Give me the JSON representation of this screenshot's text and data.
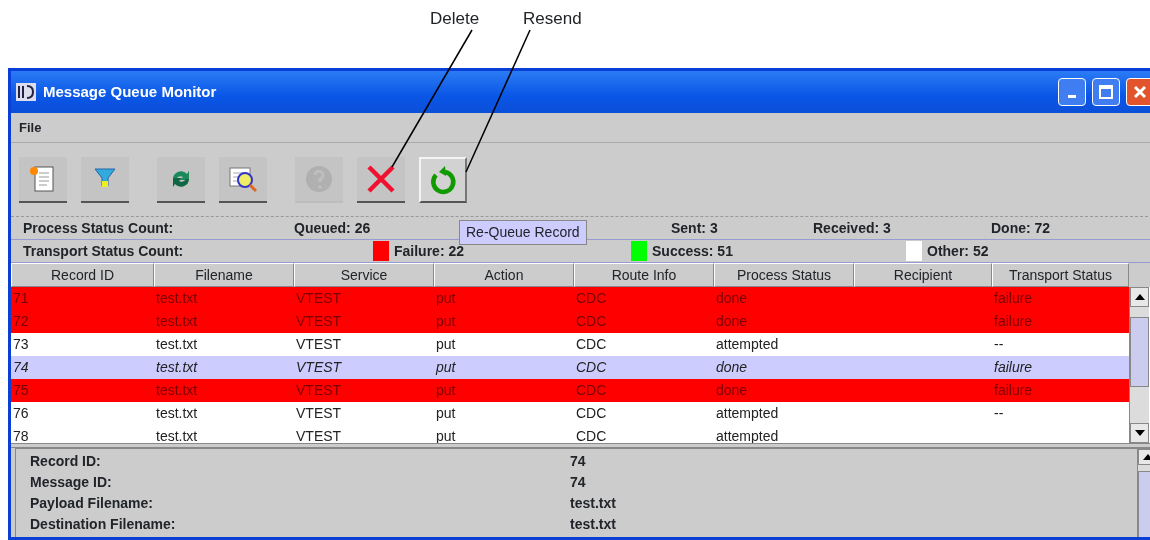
{
  "annotations": [
    {
      "label": "Delete"
    },
    {
      "label": "Resend"
    }
  ],
  "window": {
    "title": "Message Queue Monitor"
  },
  "menu": [
    {
      "label": "File"
    }
  ],
  "toolbar": [
    {
      "kind": "new",
      "disabled": false,
      "pressed": false
    },
    {
      "kind": "filter",
      "disabled": false,
      "pressed": false
    },
    {
      "kind": "refresh",
      "disabled": false,
      "pressed": false
    },
    {
      "kind": "view",
      "disabled": false,
      "pressed": false
    },
    {
      "kind": "help",
      "disabled": true,
      "pressed": false
    },
    {
      "kind": "delete",
      "disabled": false,
      "pressed": false
    },
    {
      "kind": "resend",
      "disabled": false,
      "pressed": true
    }
  ],
  "tooltip": "Re-Queue Record",
  "process_status": {
    "label": "Process Status Count:",
    "counts": [
      "Queued: 26",
      "Sent: 3",
      "Received: 3",
      "Done: 72"
    ]
  },
  "transport_status": {
    "label": "Transport Status Count:",
    "legend": [
      {
        "label": "Failure: 22",
        "color": "#ff0000"
      },
      {
        "label": "Success: 51",
        "color": "#00ff00"
      },
      {
        "label": "Other: 52",
        "color": "#ffffff"
      }
    ]
  },
  "table": {
    "columns": [
      "Record ID",
      "Filename",
      "Service",
      "Action",
      "Route Info",
      "Process Status",
      "Recipient",
      "Transport Status"
    ],
    "rows": [
      {
        "cells": [
          "71",
          "test.txt",
          "VTEST",
          "put",
          "CDC",
          "done",
          "",
          "failure"
        ],
        "failed": true,
        "selected": false
      },
      {
        "cells": [
          "72",
          "test.txt",
          "VTEST",
          "put",
          "CDC",
          "done",
          "",
          "failure"
        ],
        "failed": true,
        "selected": false
      },
      {
        "cells": [
          "73",
          "test.txt",
          "VTEST",
          "put",
          "CDC",
          "attempted",
          "",
          "--"
        ],
        "failed": false,
        "selected": false
      },
      {
        "cells": [
          "74",
          "test.txt",
          "VTEST",
          "put",
          "CDC",
          "done",
          "",
          "failure"
        ],
        "failed": true,
        "selected": true
      },
      {
        "cells": [
          "75",
          "test.txt",
          "VTEST",
          "put",
          "CDC",
          "done",
          "",
          "failure"
        ],
        "failed": true,
        "selected": false
      },
      {
        "cells": [
          "76",
          "test.txt",
          "VTEST",
          "put",
          "CDC",
          "attempted",
          "",
          "--"
        ],
        "failed": false,
        "selected": false
      },
      {
        "cells": [
          "78",
          "test.txt",
          "VTEST",
          "put",
          "CDC",
          "attempted",
          "",
          ""
        ],
        "failed": false,
        "selected": false
      }
    ]
  },
  "details": [
    {
      "label": "Record ID:",
      "value": "74"
    },
    {
      "label": "Message ID:",
      "value": "74"
    },
    {
      "label": "Payload Filename:",
      "value": "test.txt"
    },
    {
      "label": "Destination Filename:",
      "value": "test.txt"
    }
  ]
}
